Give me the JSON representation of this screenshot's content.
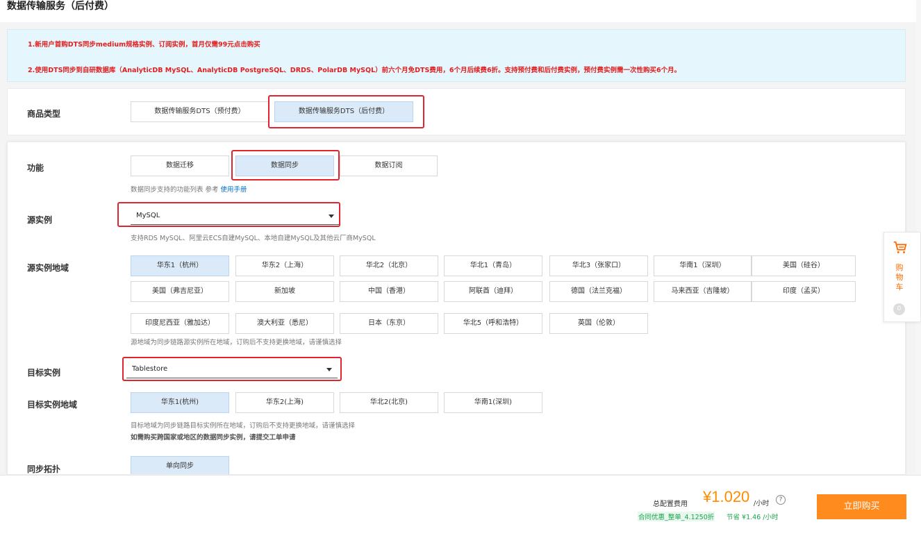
{
  "page": {
    "title": "数据传输服务（后付费）"
  },
  "notice": {
    "line1_prefix": "1.新用户首购DTS同步medium规格实例、订阅实例，首月仅需99元",
    "line1_link": "点击购买",
    "line2": "2.使用DTS同步到自研数据库（AnalyticDB MySQL、AnalyticDB PostgreSQL、DRDS、PolarDB MySQL）前六个月免DTS费用，6个月后续费6折。支持预付费和后付费实例，预付费实例需一次性购买6个月。"
  },
  "product_type": {
    "label": "商品类型",
    "options": [
      "数据传输服务DTS（预付费）",
      "数据传输服务DTS（后付费）"
    ],
    "selected_index": 1
  },
  "function": {
    "label": "功能",
    "options": [
      "数据迁移",
      "数据同步",
      "数据订阅"
    ],
    "selected_index": 1,
    "hint_prefix": "数据同步支持的功能列表 参考 ",
    "hint_link": "使用手册"
  },
  "source_instance": {
    "label": "源实例",
    "value": "MySQL",
    "hint": "支持RDS MySQL、阿里云ECS自建MySQL、本地自建MySQL及其他云厂商MySQL"
  },
  "source_region": {
    "label": "源实例地域",
    "rows": [
      [
        "华东1（杭州）",
        "华东2（上海）",
        "华北2（北京）",
        "华北1（青岛）",
        "华北3（张家口）",
        "华南1（深圳）",
        "美国（硅谷）"
      ],
      [
        "美国（弗吉尼亚）",
        "新加坡",
        "中国（香港）",
        "阿联酋（迪拜）",
        "德国（法兰克福）",
        "马来西亚（吉隆坡）",
        "印度（孟买）"
      ],
      [
        "印度尼西亚（雅加达）",
        "澳大利亚（悉尼）",
        "日本（东京）",
        "华北5（呼和浩特）",
        "英国（伦敦）"
      ]
    ],
    "selected": "华东1（杭州）",
    "hint": "源地域为同步链路源实例所在地域，订购后不支持更换地域，请谨慎选择"
  },
  "target_instance": {
    "label": "目标实例",
    "value": "Tablestore"
  },
  "target_region": {
    "label": "目标实例地域",
    "options": [
      "华东1(杭州)",
      "华东2(上海)",
      "华北2(北京)",
      "华南1(深圳)"
    ],
    "selected_index": 0,
    "hint1": "目标地域为同步链路目标实例所在地域，订购后不支持更换地域，请谨慎选择",
    "hint2": "如需购买跨国家或地区的数据同步实例，请提交工单申请"
  },
  "sync_topology": {
    "label": "同步拓扑",
    "options": [
      "单向同步"
    ],
    "selected_index": 0
  },
  "footer": {
    "total_label": "总配置费用",
    "price": "¥1.020",
    "unit": "/小时",
    "help_icon": "?",
    "discount": "合同优惠_整单_4.1250折",
    "save": "节省 ¥1.46 /小时",
    "buy_label": "立即购买"
  },
  "cart": {
    "label": "购物车",
    "count": "0",
    "icon": "shopping-cart-icon"
  },
  "colors": {
    "accent_orange": "#ff8a1e",
    "price_orange": "#ff8a00",
    "notice_red": "#e02020",
    "selected_bg": "#dbeaf8",
    "highlight_red": "#e0242e",
    "discount_green": "#1aa34a"
  }
}
